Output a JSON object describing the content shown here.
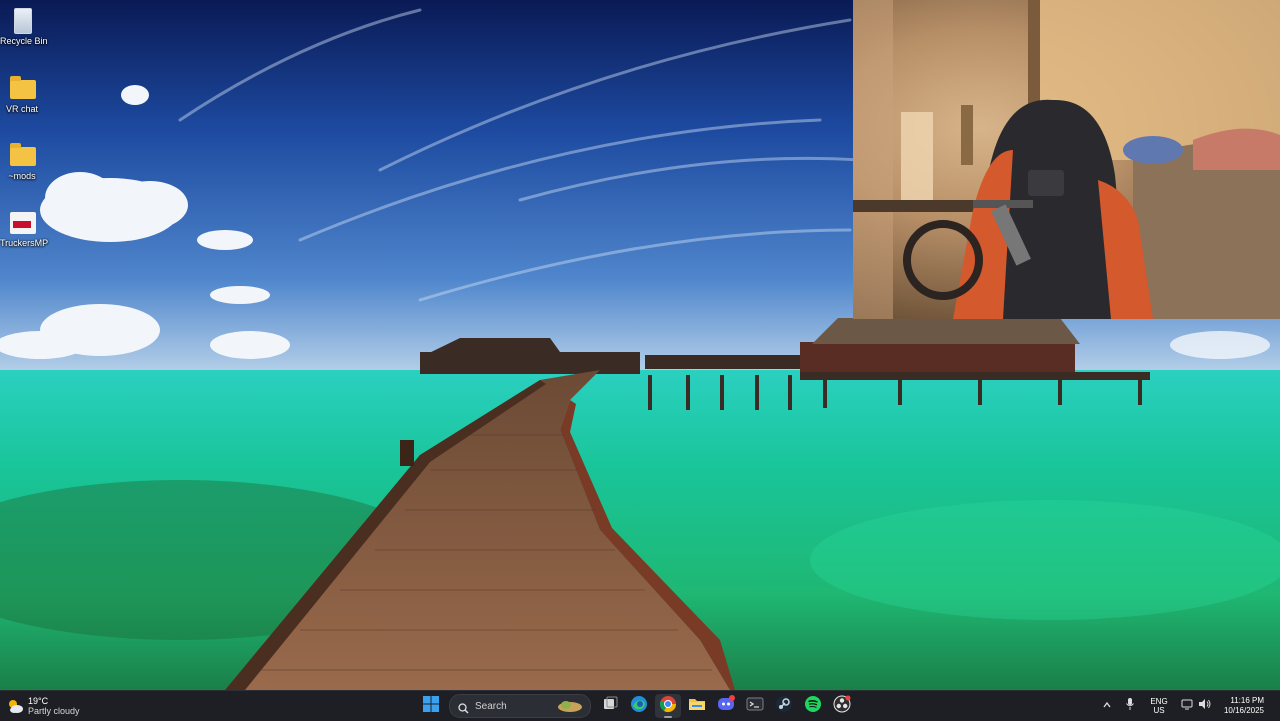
{
  "desktop": {
    "icons": [
      {
        "label": "Recycle Bin",
        "icon": "recycle-bin-icon"
      },
      {
        "label": "VR chat",
        "icon": "folder-icon"
      },
      {
        "label": "~mods",
        "icon": "folder-icon"
      },
      {
        "label": "TruckersMP",
        "icon": "truckersmp-icon"
      }
    ]
  },
  "taskbar": {
    "weather": {
      "temp": "19°C",
      "condition": "Partly cloudy"
    },
    "search": {
      "placeholder": "Search"
    },
    "apps": [
      {
        "name": "Start",
        "icon": "windows-start-icon"
      },
      {
        "name": "Search",
        "icon": "search-icon"
      },
      {
        "name": "Task View",
        "icon": "task-view-icon"
      },
      {
        "name": "Microsoft Edge",
        "icon": "edge-icon"
      },
      {
        "name": "Google Chrome",
        "icon": "chrome-icon",
        "active": true
      },
      {
        "name": "File Explorer",
        "icon": "file-explorer-icon"
      },
      {
        "name": "Discord",
        "icon": "discord-icon"
      },
      {
        "name": "Terminal",
        "icon": "terminal-icon"
      },
      {
        "name": "Steam",
        "icon": "steam-icon"
      },
      {
        "name": "Spotify",
        "icon": "spotify-icon"
      },
      {
        "name": "OBS Studio",
        "icon": "obs-icon"
      }
    ],
    "tray": {
      "language_line1": "ENG",
      "language_line2": "US",
      "time": "11:16 PM",
      "date": "10/16/2025"
    }
  },
  "colors": {
    "taskbar_bg": "#1d1f24",
    "win_blue": "#3aa0f0",
    "spotify_green": "#1ed760",
    "discord_blurple": "#5865f2"
  }
}
